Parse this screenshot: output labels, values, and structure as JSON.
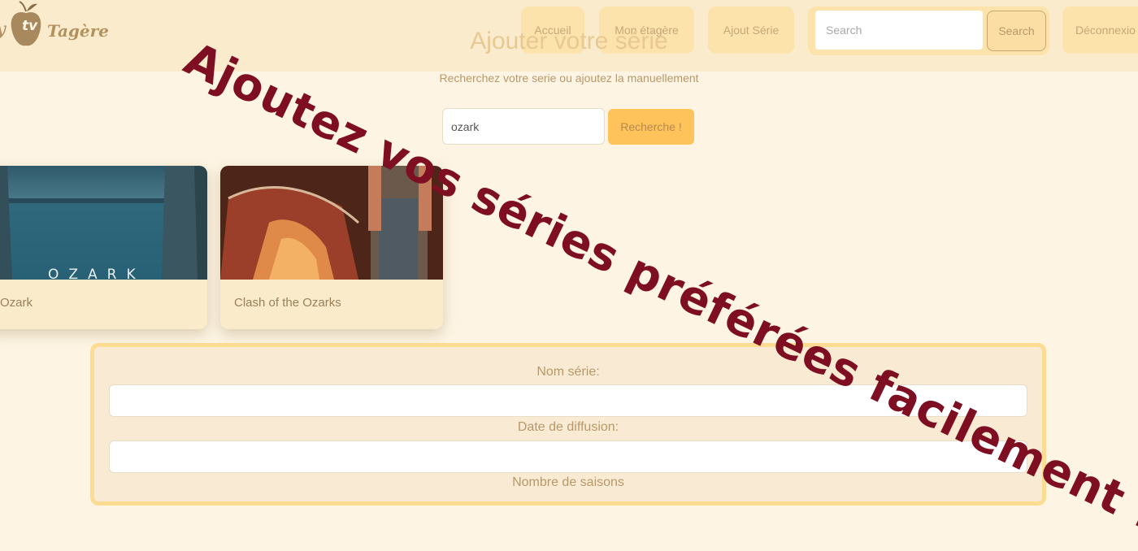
{
  "logo": {
    "left": "y",
    "center": "tv",
    "right": "Tagère"
  },
  "nav": {
    "home": "Accueil",
    "shelf": "Mon étagère",
    "add_series": "Ajout Série",
    "search_placeholder": "Search",
    "search_button": "Search",
    "logout": "Déconnexio"
  },
  "page": {
    "title": "Ajouter votre série",
    "subtitle": "Recherchez votre serie ou ajoutez la manuellement",
    "query_value": "ozark",
    "query_button": "Recherche !"
  },
  "results": [
    {
      "title": "Ozark",
      "image_text": "OZARK",
      "image_icon": "lake-scene-image"
    },
    {
      "title": "Clash of the Ozarks",
      "image_icon": "tent-scene-image"
    }
  ],
  "form": {
    "name_label": "Nom série:",
    "date_label": "Date de diffusion:",
    "seasons_label": "Nombre de saisons"
  },
  "banner": {
    "text": "Ajoutez vos séries préférées facilement !!"
  },
  "colors": {
    "background": "#fdf4e3",
    "navbar": "#faebcc",
    "nav_button": "#fce2ab",
    "accent_button": "#ffc35c",
    "banner_text": "#7e0f22",
    "form_border": "#fcdc93"
  }
}
